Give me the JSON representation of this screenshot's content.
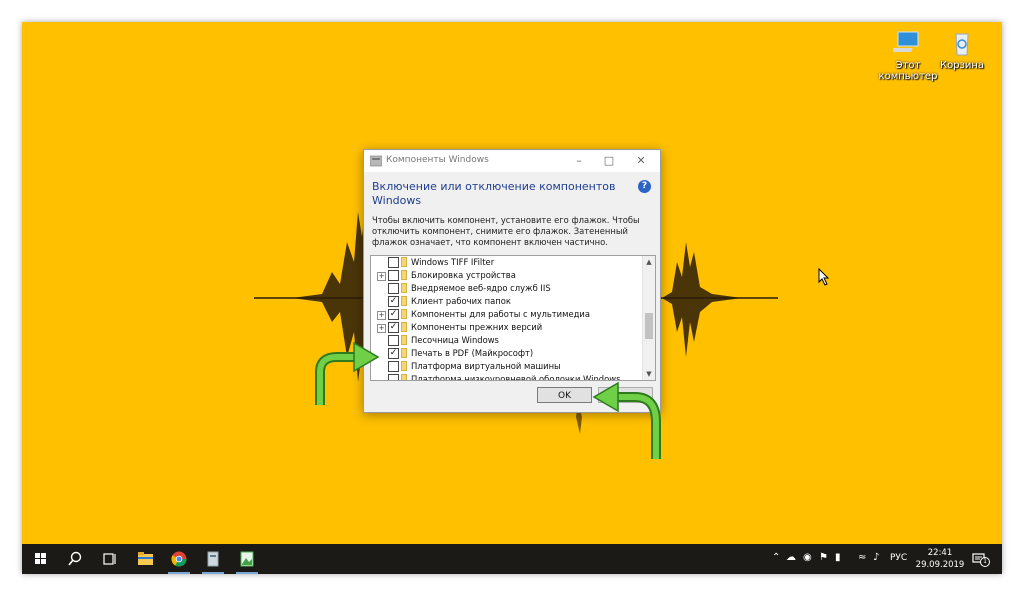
{
  "desktop": {
    "icons": [
      {
        "label": "Этот компьютер",
        "icon": "this-pc-icon"
      },
      {
        "label": "Корзина",
        "icon": "recycle-bin-icon"
      }
    ]
  },
  "dialog": {
    "title": "Компоненты Windows",
    "heading": "Включение или отключение компонентов Windows",
    "description": "Чтобы включить компонент, установите его флажок. Чтобы отключить компонент, снимите его флажок. Затененный флажок означает, что компонент включен частично.",
    "help": "?",
    "features": [
      {
        "label": "Windows TIFF IFilter",
        "checked": false,
        "expandable": false
      },
      {
        "label": "Блокировка устройства",
        "checked": false,
        "expandable": true
      },
      {
        "label": "Внедряемое веб-ядро служб IIS",
        "checked": false,
        "expandable": false
      },
      {
        "label": "Клиент рабочих папок",
        "checked": true,
        "expandable": false
      },
      {
        "label": "Компоненты для работы с мультимедиа",
        "checked": true,
        "expandable": true
      },
      {
        "label": "Компоненты прежних версий",
        "checked": true,
        "expandable": true
      },
      {
        "label": "Песочница Windows",
        "checked": false,
        "expandable": false
      },
      {
        "label": "Печать в PDF (Майкрософт)",
        "checked": true,
        "expandable": false
      },
      {
        "label": "Платформа виртуальной машины",
        "checked": false,
        "expandable": false
      },
      {
        "label": "Платформа низкоуровневой оболочки Windows",
        "checked": false,
        "expandable": false
      }
    ],
    "ok_label": "OK",
    "cancel_label": ""
  },
  "taskbar": {
    "language": "РУС",
    "time": "22:41",
    "date": "29.09.2019",
    "notification_count": "1"
  },
  "colors": {
    "wallpaper": "#ffc000",
    "arrow": "#5fbf3c",
    "taskbar": "#1c1a16",
    "heading": "#1e3d8f"
  }
}
